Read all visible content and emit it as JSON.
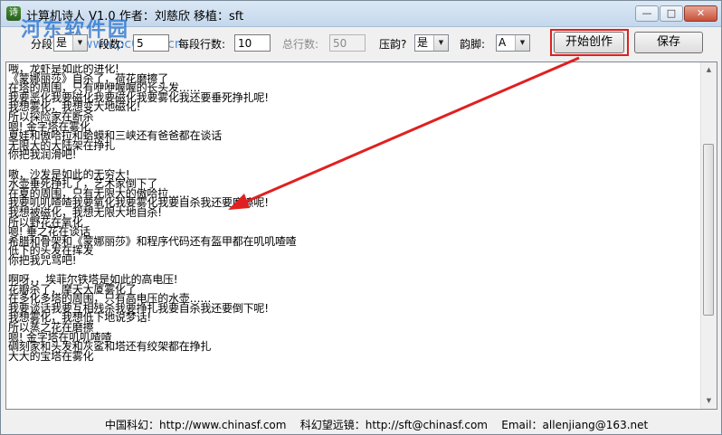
{
  "window": {
    "title": "计算机诗人 V1.0 作者：刘慈欣 移植：sft",
    "app_icon": "poet-app-icon",
    "controls": {
      "minimize": "—",
      "maximize": "□",
      "close": "✕"
    }
  },
  "watermark": {
    "name": "河东软件园",
    "url": "www.pc0359.cn"
  },
  "toolbar": {
    "segment_label": "分段?",
    "segment_value": "是",
    "paragraphs_label": "段数:",
    "paragraphs_value": "5",
    "lines_per_paragraph_label": "每段行数:",
    "lines_per_paragraph_value": "10",
    "total_lines_label": "总行数:",
    "total_lines_value": "50",
    "rhyme_label": "压韵?",
    "rhyme_value": "是",
    "rhyme_foot_label": "韵脚:",
    "rhyme_foot_value": "A",
    "start_button": "开始创作",
    "save_button": "保存"
  },
  "poem": {
    "text": "哦，龙虾是如此的进化!\n《蒙娜丽莎》自杀了，荷花磨擦了\n在塔的周围，只有咿咿喔喔的长头发……\n我要恶化我要磁化我要磁化我要雾化我还要垂死挣扎呢!\n我想雾化，我想变大地磁化!\n所以探险家在断杀\n嗯! 金字塔在雾化\n夏娃和傲哈拉和蛤蟆和三峡还有爸爸都在谈话\n无限大的大陆架在挣扎\n你把我润滑吧!\n\n嗷，沙发是如此的无穷大!\n水壶垂死挣扎了，艺术家倒下了\n在夏的周围，只有无限大的傲哈拉……\n我要叽叽喳喳我要氧化我要雾化我要自杀我还要磨擦呢!\n我想被磁化，我想无限大地自杀!\n所以野花在氧化\n嗯! 垂之花在谈话\n希腊和骨架和《蒙娜丽莎》和程序代码还有盔甲都在叽叽喳喳\n低下的头发在挥发\n你把我咒骂吧!\n\n啊呀，，埃菲尔铁塔是如此的高电压!\n花瓣杀了，摩天大厦雾化了\n在多化多塔的周围，只有高电压的水壶……\n我要谈话我要互相残杀我要挣扎我要自杀我还要倒下呢!\n我想雾化，我想低下地说梦话!\n所以蒸之花在磨擦\n嗯! 金字塔在叽叽喳喳\n碉刻家和头发和灰鲨和塔还有绞架都在挣扎\n大大的宝塔在雾化"
  },
  "status": {
    "text": "中国科幻：http://www.chinasf.com    科幻望远镜：http://sft@chinasf.com    Email：allenjiang@163.net"
  },
  "colors": {
    "accent_red": "#e02020",
    "watermark_blue": "#1f6fd1"
  }
}
